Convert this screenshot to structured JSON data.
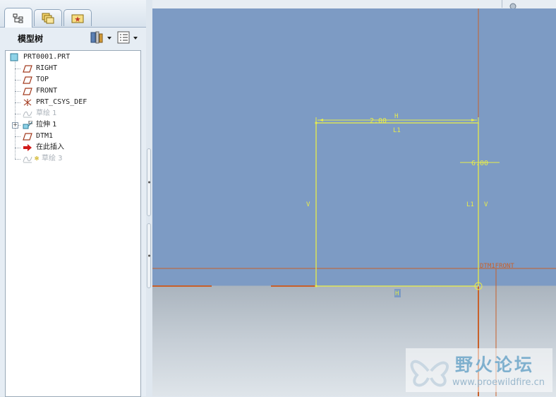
{
  "panel": {
    "title": "模型树",
    "tabs": [
      {
        "name": "model-tree-tab",
        "icon": "model-tree-icon",
        "active": true
      },
      {
        "name": "folder-browser-tab",
        "icon": "folders-icon",
        "active": false
      },
      {
        "name": "favorites-tab",
        "icon": "favorites-icon",
        "active": false
      }
    ],
    "toolbar": {
      "settings_icon": "tools-icon",
      "show_icon": "list-icon"
    }
  },
  "tree": {
    "items": [
      {
        "label": "PRT0001.PRT",
        "icon": "part-icon",
        "dim": false
      },
      {
        "label": "RIGHT",
        "icon": "datum-plane-icon",
        "dim": false
      },
      {
        "label": "TOP",
        "icon": "datum-plane-icon",
        "dim": false
      },
      {
        "label": "FRONT",
        "icon": "datum-plane-icon",
        "dim": false
      },
      {
        "label": "PRT_CSYS_DEF",
        "icon": "csys-icon",
        "dim": false
      },
      {
        "label": "草绘 1",
        "icon": "sketch-icon",
        "dim": true
      },
      {
        "label": "拉伸 1",
        "icon": "extrude-icon",
        "dim": false,
        "expandable": true
      },
      {
        "label": "DTM1",
        "icon": "datum-plane-icon",
        "dim": false
      },
      {
        "label": "在此插入",
        "icon": "insert-arrow-icon",
        "dim": false
      },
      {
        "label": "草绘 3",
        "icon": "sketch-icon",
        "dim": true,
        "active_marker": "✻"
      }
    ]
  },
  "sketch": {
    "dim_width": "2.00",
    "h_top": "H",
    "l1_top": "L1",
    "dim_right": "6.00",
    "v_left": "V",
    "l1_right": "L1",
    "v_right": "V",
    "h_bottom": "H",
    "datum_label": "DTM1FRONT"
  },
  "watermark": {
    "title": "野火论坛",
    "url": "www.proewildfire.cn"
  },
  "colors": {
    "graphics_bg": "#7d9bc4",
    "sketch": "#e8ec4a",
    "datum": "#c8602a"
  }
}
